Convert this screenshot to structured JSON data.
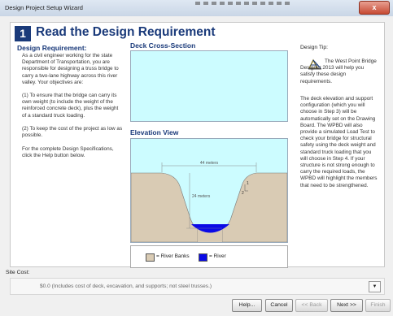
{
  "window": {
    "title": "Design Project Setup Wizard",
    "close_label": "x"
  },
  "step": {
    "number": "1",
    "title": "Read the Design Requirement"
  },
  "requirement": {
    "heading": "Design Requirement:",
    "p1": "As a civil engineer working for the state Department of Transportation, you are responsible for designing a truss bridge to carry a two-lane highway across this river valley. Your objectives are:",
    "p2": "(1) To ensure that the bridge can carry its own weight (to include the weight of the reinforced concrete deck), plus the weight of a standard truck loading.",
    "p3": "(2) To keep the cost of the project as low as possible.",
    "p4": "For the complete Design Specifications, click the Help button below."
  },
  "deck": {
    "heading": "Deck Cross-Section"
  },
  "elevation": {
    "heading": "Elevation View",
    "span_label": "44 meters",
    "height_label": "24 meters",
    "slope_rise": "1",
    "slope_run": "2"
  },
  "legend": {
    "banks_label": "= River Banks",
    "river_label": "= River"
  },
  "tip": {
    "label": "Design Tip:",
    "p1": "The West Point Bridge Designer 2013 will help you satisfy these design requirements.",
    "p2": "The deck elevation and support configuration (which you will choose in Step 3) will be automatically set on the Drawing Board. The WPBD will also provide a simulated Load Test to check your bridge for structural safety using the deck weight and standard truck loading that you will choose in Step 4. If your structure is not strong enough to carry the required loads, the WPBD will highlight the members that need to be strengthened."
  },
  "site_cost": {
    "label": "Site Cost:",
    "value": "$0.0  (Includes cost of deck, excavation, and supports; not steel trusses.)"
  },
  "buttons": {
    "help": "Help...",
    "cancel": "Cancel",
    "back": "<< Back",
    "next": "Next >>",
    "finish": "Finish"
  },
  "colors": {
    "accent": "#1a3a7a",
    "sky": "#ccfcff",
    "banks": "#d9cbb4",
    "river": "#0a0ae6"
  }
}
